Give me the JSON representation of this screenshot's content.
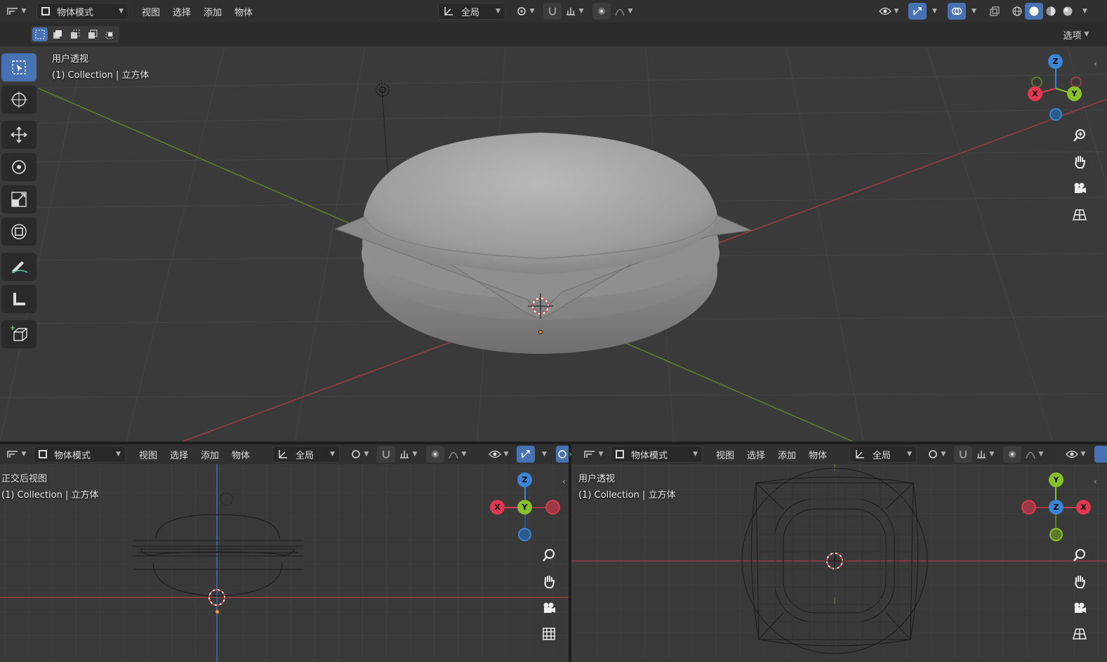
{
  "header_main": {
    "mode_label": "物体模式",
    "menus": [
      "视图",
      "选择",
      "添加",
      "物体"
    ],
    "transform_orientation": "全局",
    "options_label": "选项"
  },
  "main_view": {
    "view_name": "用户透视",
    "collection_info": "(1) Collection | 立方体"
  },
  "bottom_left": {
    "mode_label": "物体模式",
    "menus": [
      "视图",
      "选择",
      "添加",
      "物体"
    ],
    "transform_orientation": "全局",
    "view_name": "正交后视图",
    "collection_info": "(1) Collection | 立方体"
  },
  "bottom_right": {
    "mode_label": "物体模式",
    "menus": [
      "视图",
      "选择",
      "添加",
      "物体"
    ],
    "transform_orientation": "全局",
    "view_name": "用户透视",
    "collection_info": "(1) Collection | 立方体"
  },
  "gizmo_main": {
    "z": "Z",
    "y": "Y",
    "x": "X"
  },
  "gizmo_left": {
    "z": "Z",
    "y": "Y",
    "x": "X"
  },
  "gizmo_right": {
    "y": "Y",
    "z": "Z",
    "x": "X"
  },
  "colors": {
    "accent": "#4772b3",
    "axis_x": "#e0394f",
    "axis_y": "#86c12a",
    "axis_z": "#3a85d6"
  },
  "tools": [
    "select-box-icon",
    "cursor-icon",
    "move-icon",
    "rotate-icon",
    "scale-icon",
    "transform-icon",
    "annotate-icon",
    "measure-icon",
    "add-cube-icon"
  ]
}
